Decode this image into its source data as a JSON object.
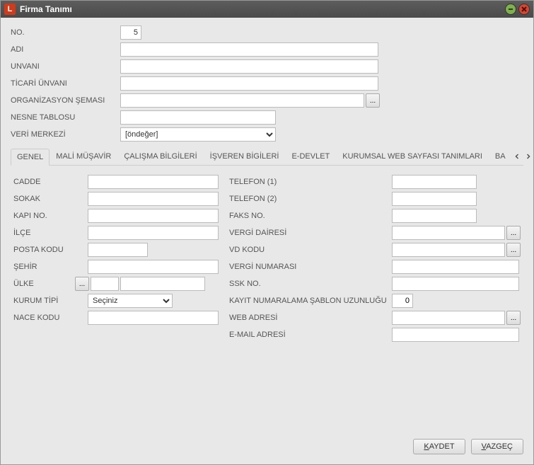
{
  "window": {
    "title": "Firma Tanımı",
    "icon_char": "L"
  },
  "top_form": {
    "no": {
      "label": "NO.",
      "value": "5"
    },
    "adi": {
      "label": "ADI",
      "value": ""
    },
    "unvani": {
      "label": "UNVANI",
      "value": ""
    },
    "ticari_unvani": {
      "label": "TİCARİ ÜNVANI",
      "value": ""
    },
    "org_semasi": {
      "label": "ORGANİZASYON ŞEMASI",
      "value": ""
    },
    "nesne_tablosu": {
      "label": "NESNE TABLOSU",
      "value": ""
    },
    "veri_merkezi": {
      "label": "VERİ MERKEZİ",
      "value": "[öndeğer]"
    }
  },
  "tabs": [
    {
      "label": "GENEL",
      "active": true
    },
    {
      "label": "MALİ MÜŞAVİR",
      "active": false
    },
    {
      "label": "ÇALIŞMA BİLGİLERİ",
      "active": false
    },
    {
      "label": "İŞVEREN BİGİLERİ",
      "active": false
    },
    {
      "label": "E-DEVLET",
      "active": false
    },
    {
      "label": "KURUMSAL WEB SAYFASI TANIMLARI",
      "active": false
    },
    {
      "label": "BA",
      "active": false
    }
  ],
  "left_fields": {
    "cadde": {
      "label": "CADDE",
      "value": ""
    },
    "sokak": {
      "label": "SOKAK",
      "value": ""
    },
    "kapi_no": {
      "label": "KAPI NO.",
      "value": ""
    },
    "ilce": {
      "label": "İLÇE",
      "value": ""
    },
    "posta_kodu": {
      "label": "POSTA KODU",
      "value": ""
    },
    "sehir": {
      "label": "ŞEHİR",
      "value": ""
    },
    "ulke": {
      "label": "ÜLKE",
      "value1": "",
      "value2": ""
    },
    "kurum_tipi": {
      "label": "KURUM TİPİ",
      "value": "Seçiniz"
    },
    "nace_kodu": {
      "label": "NACE KODU",
      "value": ""
    }
  },
  "right_fields": {
    "telefon1": {
      "label": "TELEFON (1)",
      "value": ""
    },
    "telefon2": {
      "label": "TELEFON (2)",
      "value": ""
    },
    "faks_no": {
      "label": "FAKS NO.",
      "value": ""
    },
    "vergi_dairesi": {
      "label": "VERGİ DAİRESİ",
      "value": ""
    },
    "vd_kodu": {
      "label": "VD KODU",
      "value": ""
    },
    "vergi_numarasi": {
      "label": "VERGİ NUMARASI",
      "value": ""
    },
    "ssk_no": {
      "label": "SSK NO.",
      "value": ""
    },
    "kayit_sablon": {
      "label": "KAYIT NUMARALAMA ŞABLON UZUNLUĞU",
      "value": "0"
    },
    "web_adresi": {
      "label": "WEB ADRESİ",
      "value": ""
    },
    "email_adresi": {
      "label": "E-MAIL ADRESİ",
      "value": ""
    }
  },
  "footer": {
    "save": "KAYDET",
    "cancel": "VAZGEÇ"
  },
  "dots": "..."
}
